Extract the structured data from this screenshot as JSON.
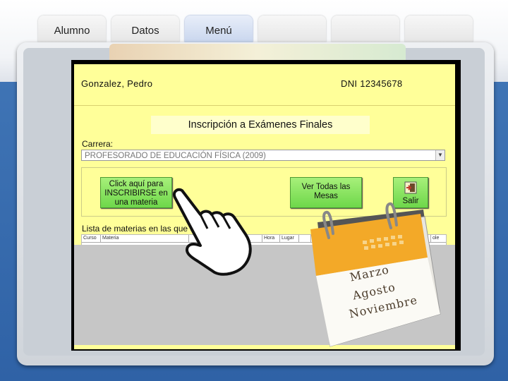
{
  "tabs": [
    {
      "label": "Alumno",
      "active": false
    },
    {
      "label": "Datos",
      "active": false
    },
    {
      "label": "Menú",
      "active": true
    },
    {
      "label": "",
      "active": false
    },
    {
      "label": "",
      "active": false
    },
    {
      "label": "",
      "active": false
    }
  ],
  "student": {
    "name": "Gonzalez, Pedro",
    "dni": "DNI 12345678"
  },
  "page": {
    "title": "Inscripción a Exámenes Finales"
  },
  "carrera": {
    "label": "Carrera:",
    "selected": "PROFESORADO DE EDUCACIÓN FÍSICA (2009)"
  },
  "buttons": {
    "inscribir_line1": "Click aquí para",
    "inscribir_line2": "INSCRIBIRSE en",
    "inscribir_line3": "una materia",
    "mesas_line1": "Ver Todas las",
    "mesas_line2": "Mesas",
    "salir": "Salir"
  },
  "list": {
    "label": "Lista de materias en las que está inscripto:",
    "columns": [
      "Curso",
      "Materia",
      "",
      "",
      "",
      "",
      "Hora",
      "Lugar",
      "",
      "",
      "",
      "",
      "",
      "",
      "",
      "",
      "",
      "",
      "",
      "ole"
    ]
  },
  "calendar": {
    "months": [
      "Marzo",
      "Agosto",
      "Noviembre"
    ]
  },
  "colors": {
    "app_background": "#ffff99",
    "button_green": "#7ee05a",
    "page_blue": "#2f62a6"
  },
  "icons": {
    "exit": "exit-door-arrow-icon",
    "hand": "pointing-hand-icon",
    "calendar": "calendar-icon"
  }
}
